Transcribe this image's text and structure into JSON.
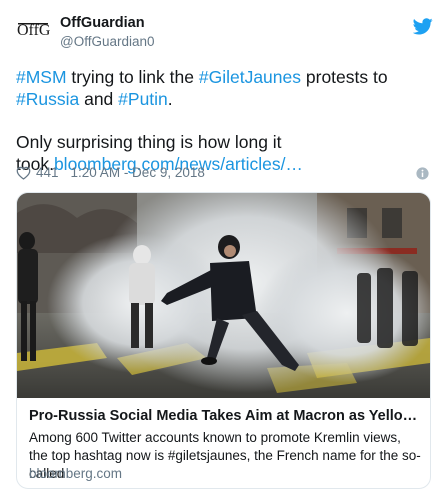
{
  "author": {
    "name": "OffGuardian",
    "handle": "@OffGuardian0",
    "avatar_text": "OffG"
  },
  "tweet": {
    "line1": {
      "tag1": "#MSM",
      "text1": " trying to link the ",
      "tag2": "#GiletJaunes",
      "text2": " protests to ",
      "tag3": "#Russia",
      "text3": " and ",
      "tag4": "#Putin",
      "text4": "."
    },
    "line2": {
      "text": "Only surprising thing is how long it took.",
      "link": "bloomberg.com/news/articles/…"
    }
  },
  "meta": {
    "likes": "441",
    "timestamp": "1:20 AM - Dec 9, 2018"
  },
  "card": {
    "title": "Pro-Russia Social Media Takes Aim at Macron as Yellow Vests…",
    "description": "Among 600 Twitter accounts known to promote Kremlin views, the top hashtag now is #giletsjaunes, the French name for the so-called",
    "domain": "bloomberg.com"
  },
  "colors": {
    "link": "#1b95e0",
    "secondary_text": "#657786",
    "twitter_blue": "#1da1f2"
  },
  "icons": [
    "twitter-bird-icon",
    "heart-icon",
    "info-icon"
  ]
}
